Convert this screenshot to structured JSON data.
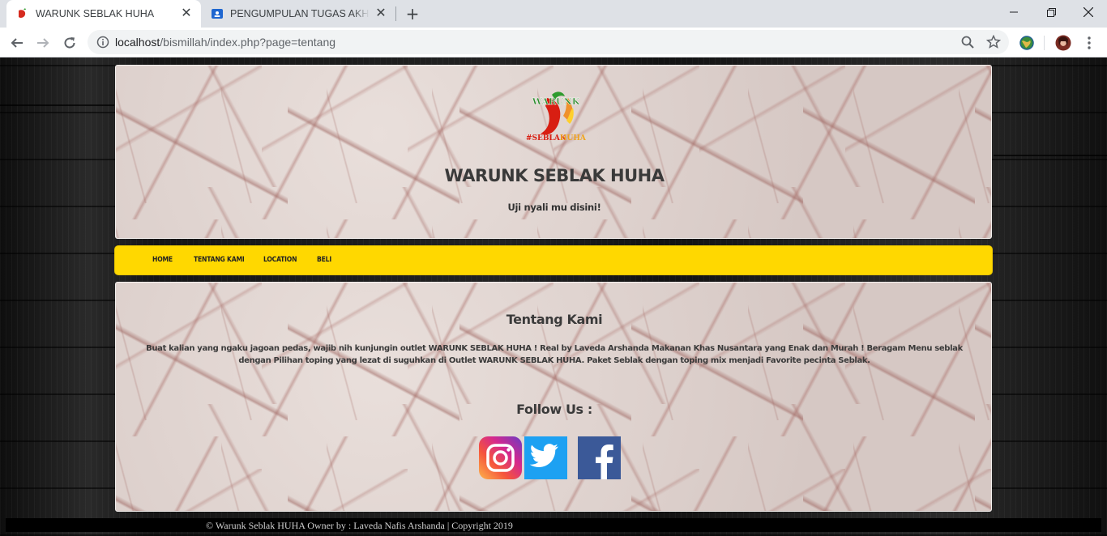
{
  "browser": {
    "tabs": [
      {
        "title": "WARUNK SEBLAK HUHA",
        "active": true
      },
      {
        "title": "PENGUMPULAN TUGAS AKHIR W",
        "active": false
      }
    ],
    "address": {
      "host": "localhost",
      "path": "/bismillah/index.php?page=tentang"
    }
  },
  "header": {
    "logo": {
      "text_top": "WARUNK",
      "text_bottom_left": "#SEBLAK",
      "text_bottom_right": "HUHA"
    },
    "title": "WARUNK SEBLAK HUHA",
    "tagline": "Uji nyali mu disini!"
  },
  "nav": {
    "items": [
      {
        "label": "HOME"
      },
      {
        "label": "TENTANG KAMI"
      },
      {
        "label": "LOCATION"
      },
      {
        "label": "BELI"
      }
    ]
  },
  "content": {
    "title": "Tentang Kami",
    "body": "Buat kalian yang ngaku jagoan pedas, wajib nih kunjungin outlet WARUNK SEBLAK HUHA ! Real by Laveda Arshanda Makanan Khas Nusantara yang Enak dan Murah ! Beragam Menu seblak dengan Pilihan toping yang lezat di suguhkan di Outlet WARUNK SEBLAK HUHA. Paket Seblak dengan toping mix menjadi Favorite pecinta Seblak.",
    "follow_title": "Follow Us :",
    "social": [
      {
        "icon": "instagram-icon",
        "color": "#c13584"
      },
      {
        "icon": "twitter-icon",
        "color": "#1da1f2"
      },
      {
        "icon": "facebook-icon",
        "color": "#3b5998"
      }
    ]
  },
  "footer": {
    "text": "© Warunk Seblak HUHA Owner by : Laveda Nafis Arshanda | Copyright 2019"
  },
  "colors": {
    "nav_bg": "#ffd800",
    "title_text": "#3a3a3a",
    "footer_bg": "#000000"
  }
}
